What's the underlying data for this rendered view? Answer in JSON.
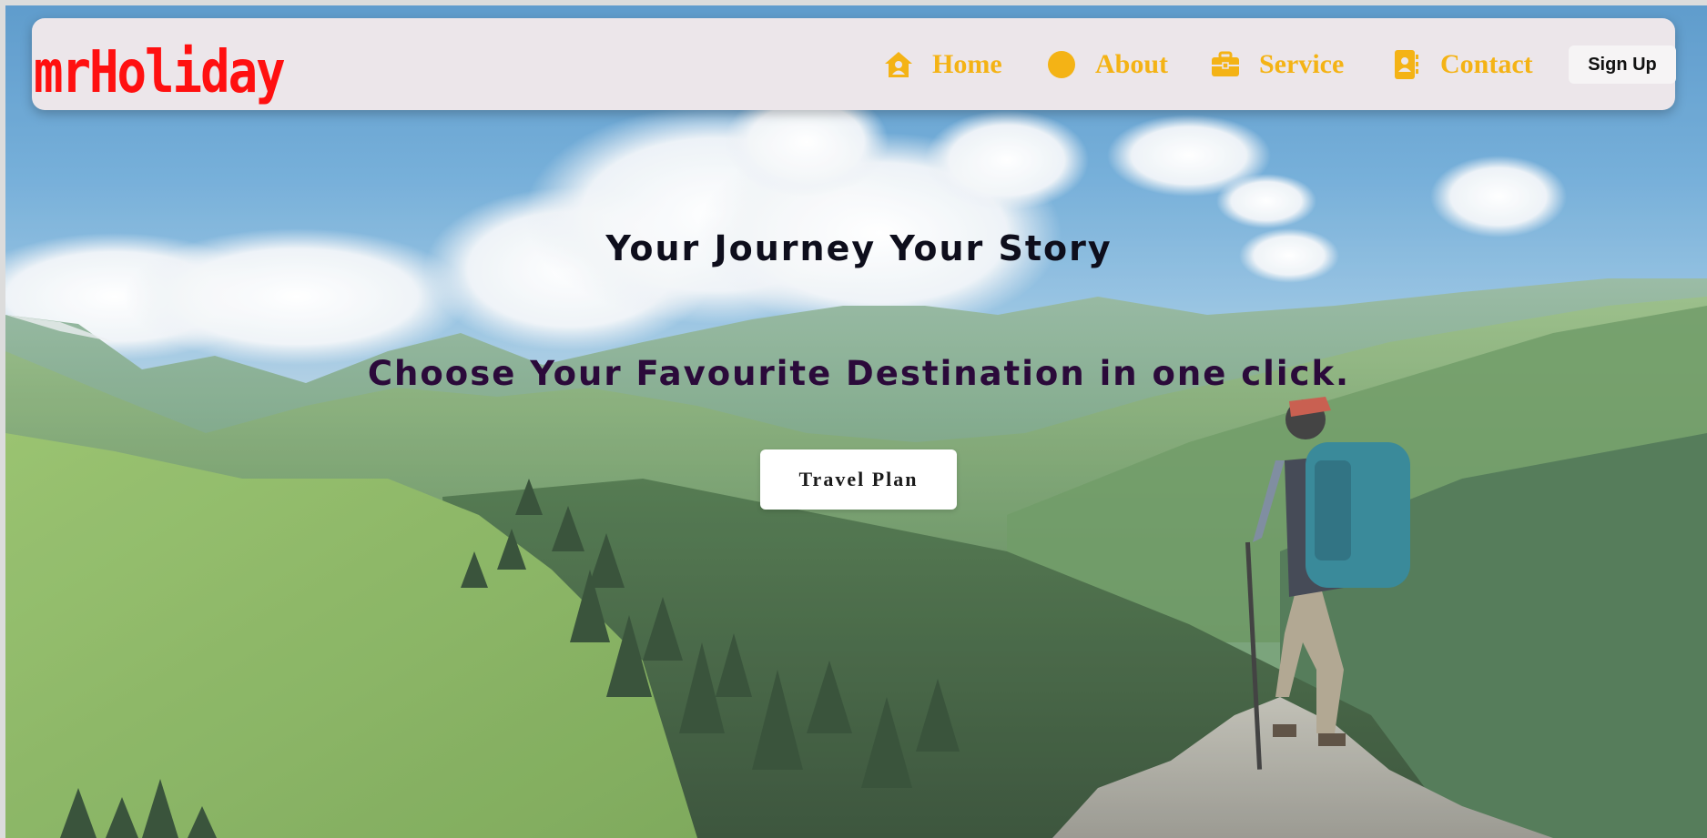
{
  "brand": {
    "logo": "mrHoliday",
    "logo_color": "#ff1010"
  },
  "nav": {
    "items": [
      {
        "label": "Home",
        "icon": "home-icon"
      },
      {
        "label": "About",
        "icon": "circle-icon"
      },
      {
        "label": "Service",
        "icon": "briefcase-icon"
      },
      {
        "label": "Contact",
        "icon": "contact-book-icon"
      }
    ],
    "accent_color": "#f4b315",
    "signup_label": "Sign Up"
  },
  "hero": {
    "title": "Your Journey Your Story",
    "subtitle": "Choose Your Favourite Destination in one click.",
    "cta_label": "Travel Plan",
    "background": "mountain-landscape-with-hiker"
  }
}
